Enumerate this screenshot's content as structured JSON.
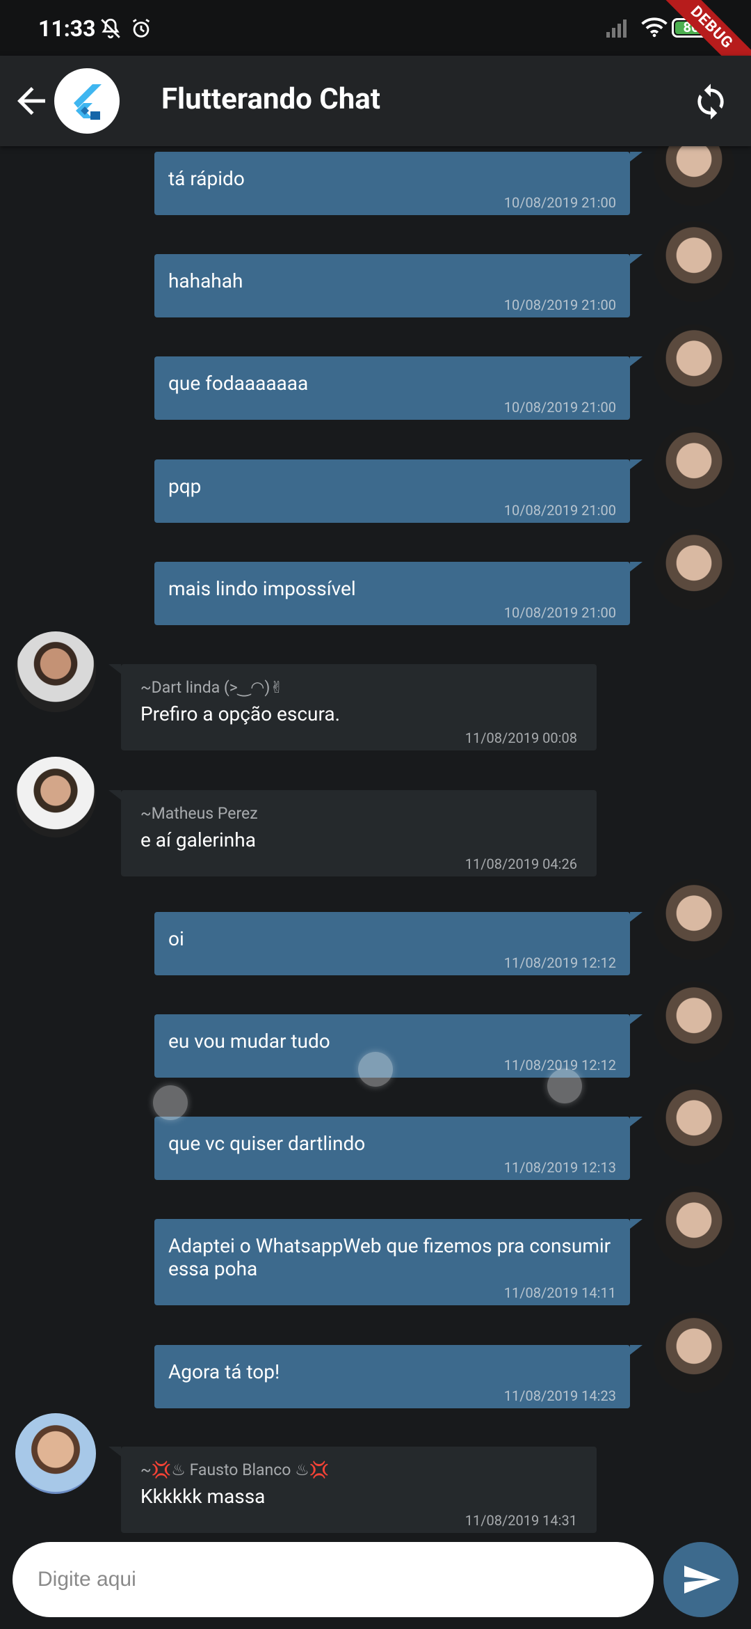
{
  "status_bar": {
    "time": "11:33",
    "battery": "86",
    "debug_label": "DEBUG"
  },
  "app_bar": {
    "title": "Flutterando Chat"
  },
  "messages": [
    {
      "kind": "out",
      "text": "tá rápido",
      "time": "10/08/2019 21:00"
    },
    {
      "kind": "out",
      "text": "hahahah",
      "time": "10/08/2019 21:00"
    },
    {
      "kind": "out",
      "text": "que fodaaaaaaa",
      "time": "10/08/2019 21:00"
    },
    {
      "kind": "out",
      "text": "pqp",
      "time": "10/08/2019 21:00"
    },
    {
      "kind": "out",
      "text": "mais lindo impossível",
      "time": "10/08/2019 21:00"
    },
    {
      "kind": "in",
      "sender": "~Dart linda     (>‿◠)✌",
      "text": "Prefiro a opção escura.",
      "time": "11/08/2019 00:08"
    },
    {
      "kind": "in",
      "sender": "~Matheus Perez",
      "text": "e aí galerinha",
      "time": "11/08/2019 04:26"
    },
    {
      "kind": "out",
      "text": "oi",
      "time": "11/08/2019 12:12"
    },
    {
      "kind": "out",
      "text": "eu vou mudar tudo",
      "time": "11/08/2019 12:12"
    },
    {
      "kind": "out",
      "text": "que vc quiser dartlindo",
      "time": "11/08/2019 12:13"
    },
    {
      "kind": "out",
      "text": "Adaptei o WhatsappWeb que fizemos pra consumir essa poha",
      "time": "11/08/2019 14:11"
    },
    {
      "kind": "out",
      "text": "Agora tá top!",
      "time": "11/08/2019 14:23"
    },
    {
      "kind": "in",
      "sender": "~💢♨ Fausto Blanco ♨💢",
      "text": "Kkkkkk massa",
      "time": "11/08/2019 14:31"
    }
  ],
  "composer": {
    "placeholder": "Digite aqui"
  },
  "colors": {
    "accent": "#3d6a8d",
    "incoming_bubble": "#25292c",
    "background": "#181a1c"
  },
  "icons": [
    "notifications-off-icon",
    "alarm-icon",
    "signal-icon",
    "wifi-icon",
    "battery-icon",
    "back-arrow-icon",
    "flutter-logo-icon",
    "refresh-icon",
    "send-icon"
  ]
}
